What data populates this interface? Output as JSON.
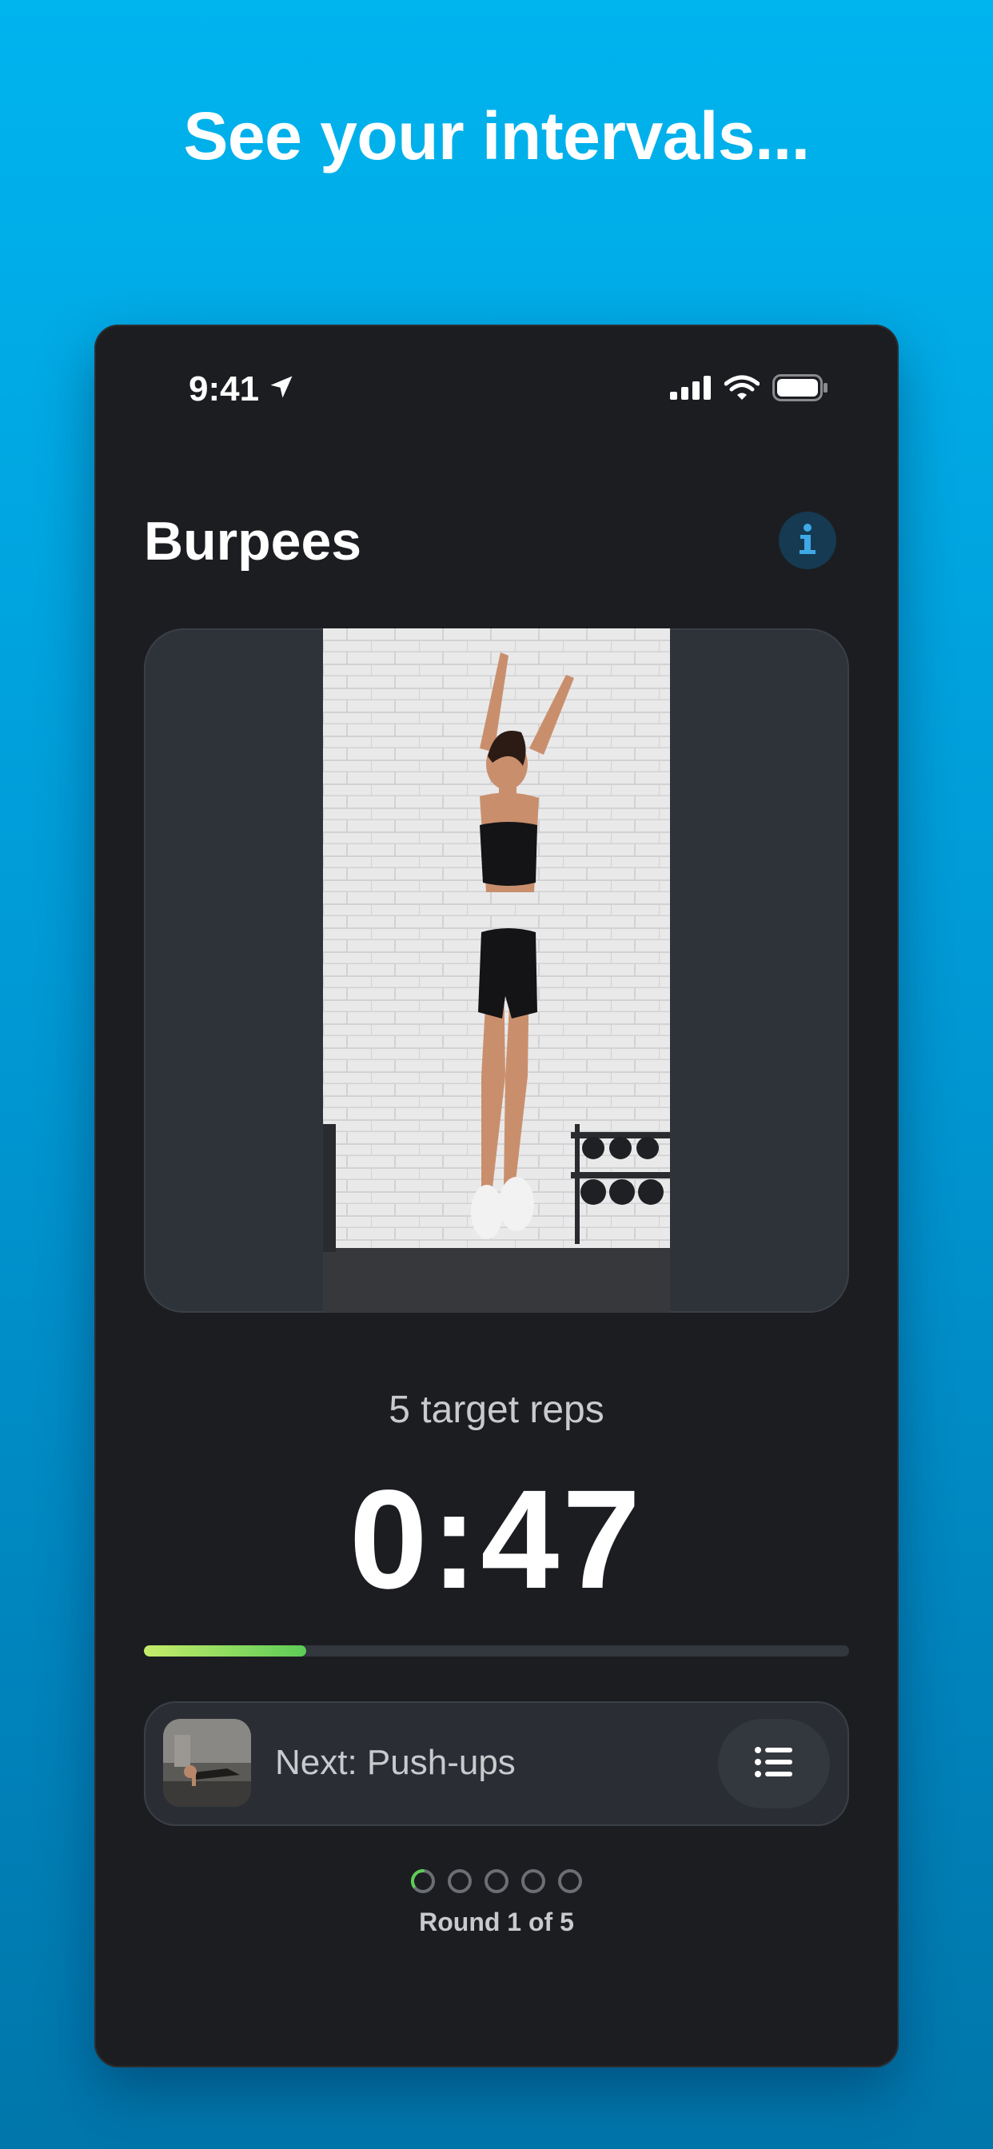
{
  "headline": "See your intervals...",
  "status_bar": {
    "time": "9:41",
    "icons": [
      "location-arrow-icon",
      "cellular-signal-icon",
      "wifi-icon",
      "battery-icon"
    ]
  },
  "exercise": {
    "name": "Burpees",
    "info_icon": "info-icon",
    "target_reps": "5 target reps",
    "timer": "0:47",
    "progress_fraction": 0.23
  },
  "next": {
    "label": "Next: Push-ups",
    "list_icon": "list-icon"
  },
  "rounds": {
    "label": "Round 1 of 5",
    "current": 1,
    "total": 5
  },
  "colors": {
    "background_top": "#00b4ee",
    "background_bottom": "#0076aa",
    "phone_bg": "#1c1d21",
    "progress_start": "#c6ec6a",
    "progress_end": "#5ccc57",
    "info_accent": "#3fa9e6"
  }
}
